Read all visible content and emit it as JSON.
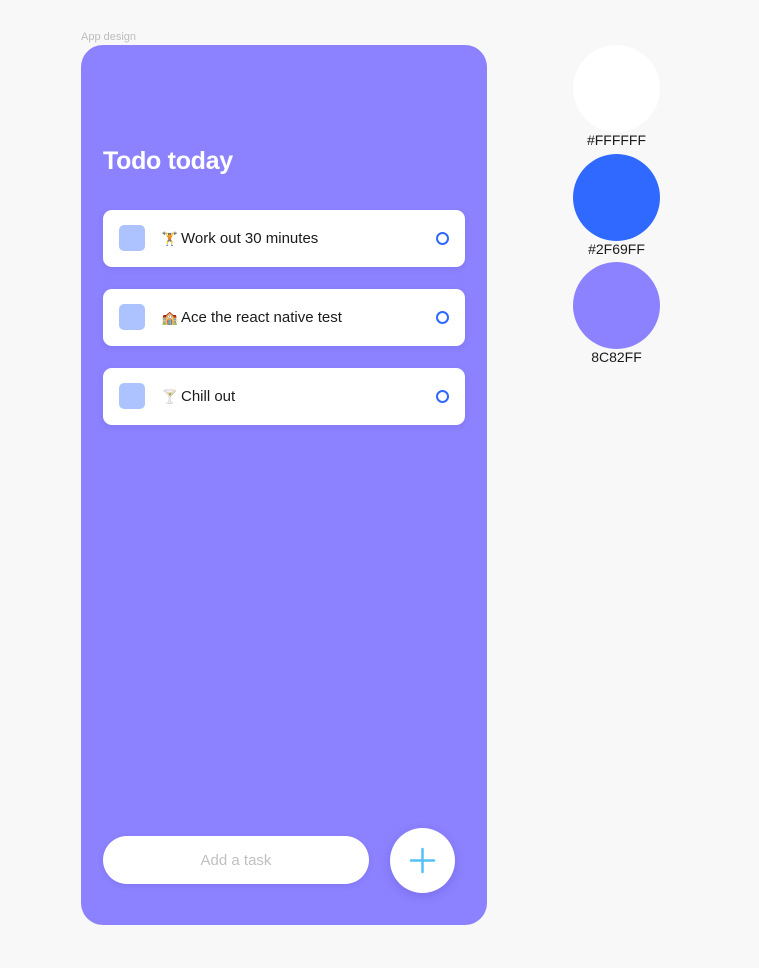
{
  "frame_label": "App design",
  "app": {
    "title": "Todo today",
    "tasks": [
      {
        "emoji": "🏋",
        "label": "Work out 30 minutes"
      },
      {
        "emoji": "🏫",
        "label": "Ace the react native test"
      },
      {
        "emoji": "🍸",
        "label": "Chill out"
      }
    ],
    "input_placeholder": "Add a task",
    "add_icon": "plus-icon"
  },
  "palette": [
    {
      "hex": "#FFFFFF",
      "label": "#FFFFFF"
    },
    {
      "hex": "#2F69FF",
      "label": "#2F69FF"
    },
    {
      "hex": "#8C82FF",
      "label": "8C82FF"
    }
  ],
  "colors": {
    "background": "#8C82FF",
    "accent": "#2F69FF",
    "task_square": "#ADC3FF",
    "plus": "#55C1F5"
  }
}
